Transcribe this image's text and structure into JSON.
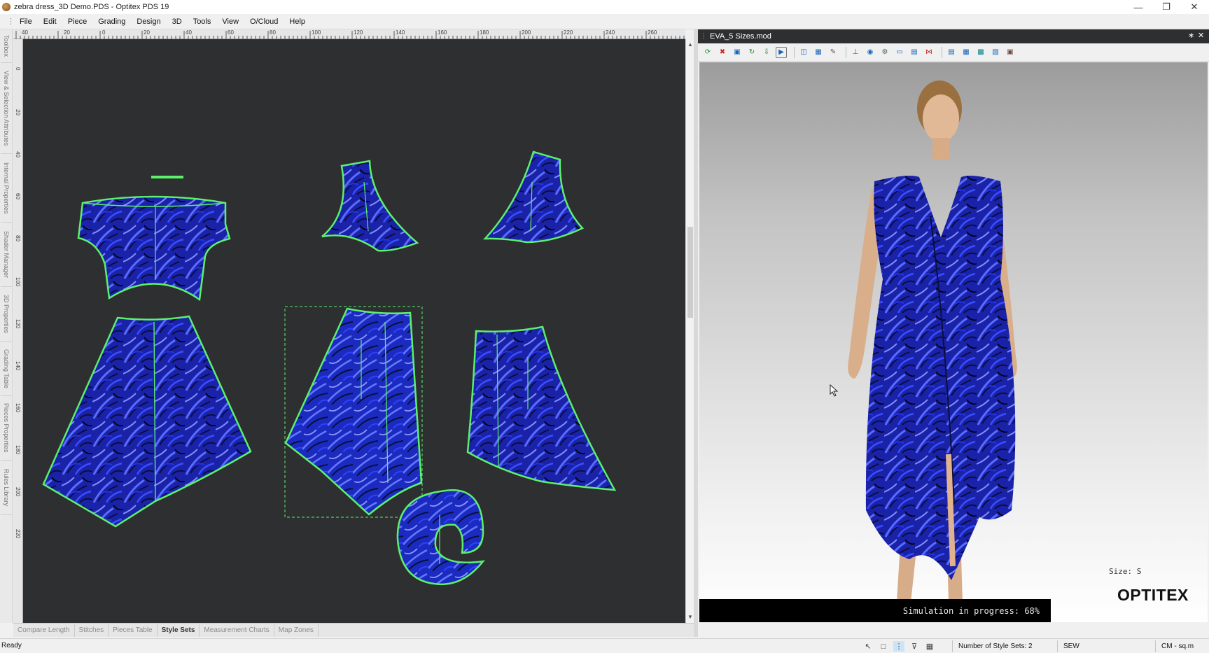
{
  "window": {
    "title": "zebra dress_3D Demo.PDS - Optitex PDS 19",
    "minimize_icon": "minimize-icon",
    "restore_icon": "restore-icon",
    "close_icon": "close-icon"
  },
  "menu": {
    "items": [
      "File",
      "Edit",
      "Piece",
      "Grading",
      "Design",
      "3D",
      "Tools",
      "View",
      "O/Cloud",
      "Help"
    ]
  },
  "sidebar": {
    "tabs": [
      "Toolbox",
      "View & Selection Attributes",
      "Internal Properties",
      "Shader Manager",
      "3D Properties",
      "Grading Table",
      "Pieces Properties",
      "Rules Library"
    ]
  },
  "ruler": {
    "top_labels": [
      "40",
      "20",
      "0",
      "20",
      "40",
      "60",
      "80",
      "100",
      "120",
      "140",
      "160",
      "180",
      "200",
      "220",
      "240",
      "260"
    ],
    "left_labels": [
      "0",
      "20",
      "40",
      "60",
      "80",
      "100",
      "120",
      "140",
      "160",
      "180",
      "200",
      "220"
    ]
  },
  "bottom_tabs": [
    {
      "label": "Compare Length",
      "active": false
    },
    {
      "label": "Stitches",
      "active": false
    },
    {
      "label": "Pieces Table",
      "active": false
    },
    {
      "label": "Style Sets",
      "active": true
    },
    {
      "label": "Measurement Charts",
      "active": false
    },
    {
      "label": "Map Zones",
      "active": false
    }
  ],
  "panel3d": {
    "title": "EVA_5 Sizes.mod",
    "toolbar_icons": [
      "refresh-icon",
      "delete-icon",
      "image-icon",
      "cycle-icon",
      "down-arrow-icon",
      "play-icon",
      "layout-icon",
      "frame-icon",
      "brush-icon",
      "axis-icon",
      "camera-icon",
      "settings-icon",
      "monitor-icon",
      "image-icon",
      "cross-icon",
      "chart-icon",
      "table-icon",
      "grid-icon",
      "layers-icon",
      "display-icon"
    ],
    "size_label": "Size: S",
    "simulation_text": "Simulation in progress: 68%",
    "logo": "OPTITEX"
  },
  "colors": {
    "canvas_bg": "#2d2f31",
    "fabric_blue": "#2a3de0",
    "outline_green": "#5cf06c"
  },
  "status": {
    "ready": "Ready",
    "style_sets": "Number of Style Sets: 2",
    "mode": "SEW",
    "units": "CM - sq.m"
  }
}
